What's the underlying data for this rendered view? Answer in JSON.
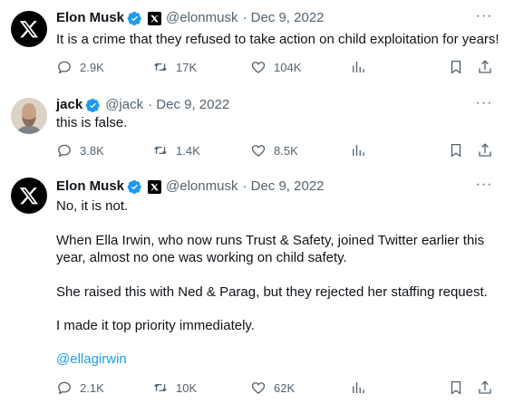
{
  "tweets": [
    {
      "name": "Elon Musk",
      "handle": "@elonmusk",
      "date": "· Dec 9, 2022",
      "lines": [
        "It is a crime that they refused to take action on child exploitation for years!"
      ],
      "replies": "2.9K",
      "retweets": "17K",
      "likes": "104K"
    },
    {
      "name": "jack",
      "handle": "@jack",
      "date": "· Dec 9, 2022",
      "lines": [
        "this is false."
      ],
      "replies": "3.8K",
      "retweets": "1.4K",
      "likes": "8.5K"
    },
    {
      "name": "Elon Musk",
      "handle": "@elonmusk",
      "date": "· Dec 9, 2022",
      "lines": [
        "No, it is not.",
        "When Ella Irwin, who now runs Trust & Safety, joined Twitter earlier this",
        "year, almost no one was working on child safety.",
        "She raised this with Ned & Parag, but they rejected her staffing request.",
        "I made it top priority immediately."
      ],
      "mention": "@ellagirwin",
      "replies": "2.1K",
      "retweets": "10K",
      "likes": "62K"
    }
  ],
  "colors": {
    "accent": "#1d9bf0",
    "muted": "#536471",
    "text": "#0f1419"
  },
  "icons": [
    "x-logo-icon",
    "verified-badge-icon",
    "x-affiliate-icon",
    "more-icon",
    "reply-icon",
    "retweet-icon",
    "like-icon",
    "views-icon",
    "bookmark-icon",
    "share-icon"
  ]
}
